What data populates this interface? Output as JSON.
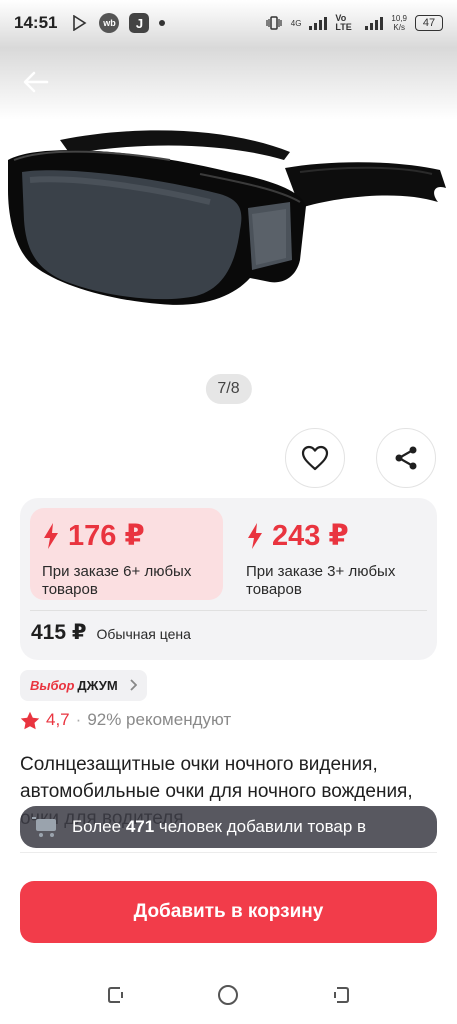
{
  "status_bar": {
    "time": "14:51",
    "app_wb": "wb",
    "app_j": "J",
    "network_4g": "4G",
    "volte": "Vo LTE",
    "net_speed_value": "10,9",
    "net_speed_unit": "K/s",
    "battery": "47"
  },
  "gallery": {
    "counter": "7/8"
  },
  "prices": {
    "option1": {
      "price": "176 ₽",
      "caption": "При заказе 6+ любых товаров"
    },
    "option2": {
      "price": "243 ₽",
      "caption": "При заказе 3+ любых товаров"
    },
    "regular_price": "415 ₽",
    "regular_label": "Обычная цена"
  },
  "choice_badge": {
    "brand": "Выбор",
    "name": "ДЖУМ"
  },
  "rating": {
    "value": "4,7",
    "separator": "·",
    "recommend": "92% рекомендуют"
  },
  "product": {
    "title": "Солнцезащитные очки ночного видения, автомобильные очки для ночного вождения, очки для водителя"
  },
  "toast": {
    "prefix": "Более",
    "count": "471",
    "suffix": "человек добавили товар в"
  },
  "cart": {
    "add_label": "Добавить в корзину"
  },
  "colors": {
    "accent": "#e9343f",
    "button": "#f23c4a",
    "active_option_bg": "#fbdfe1"
  }
}
